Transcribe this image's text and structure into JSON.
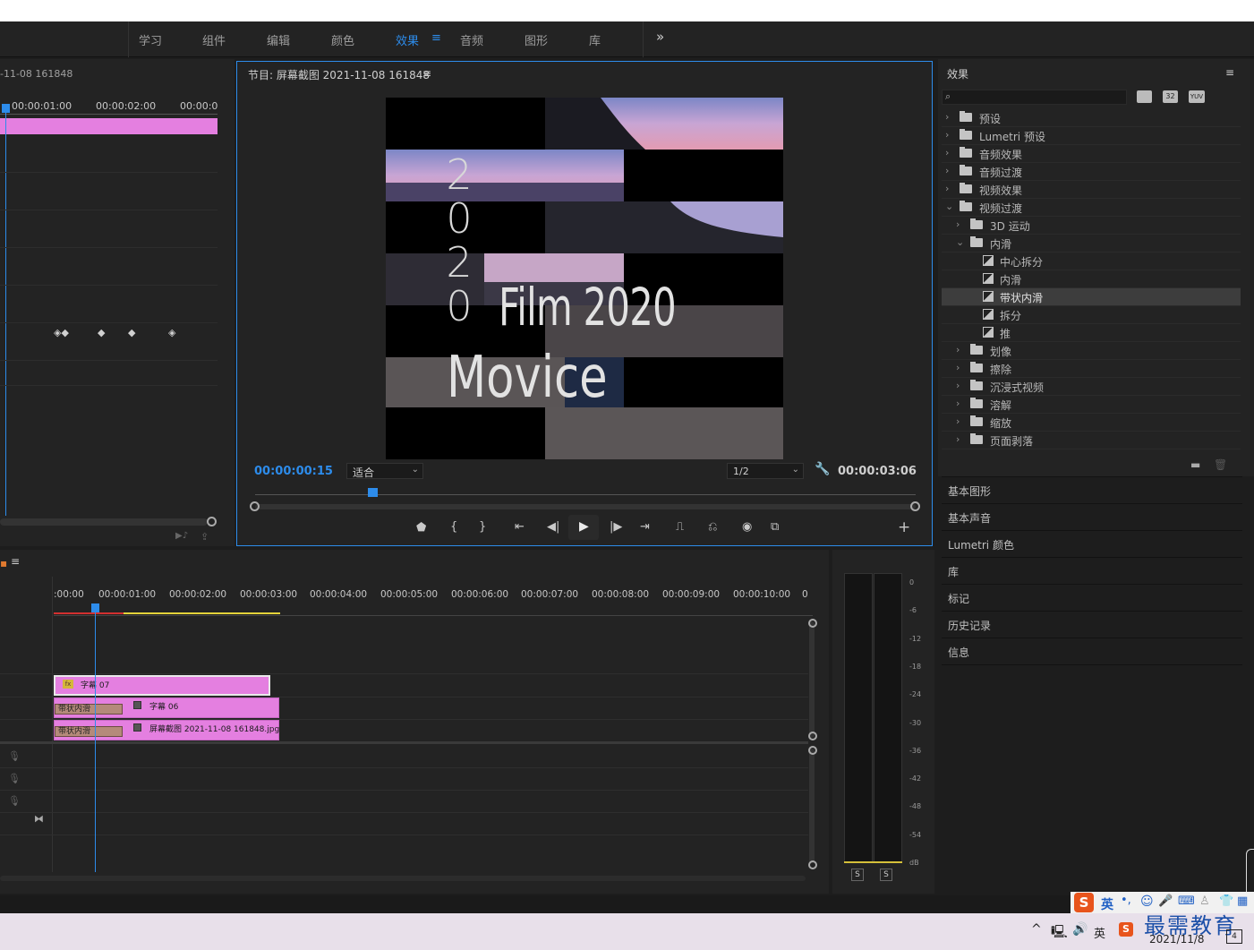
{
  "workspace_tabs": [
    {
      "label": "学习"
    },
    {
      "label": "组件"
    },
    {
      "label": "编辑"
    },
    {
      "label": "颜色"
    },
    {
      "label": "效果"
    },
    {
      "label": "音频"
    },
    {
      "label": "图形"
    },
    {
      "label": "库"
    }
  ],
  "workspace_more": "»",
  "source_panel": {
    "title": "-11-08 161848",
    "ruler": [
      "00:00:01:00",
      "00:00:02:00",
      "00:00:0"
    ]
  },
  "program_monitor": {
    "title": "节目: 屏幕截图 2021-11-08 161848",
    "menu_icon": "≡",
    "timecode": "00:00:00:15",
    "fit_select": "适合",
    "resolution_select": "1/2",
    "duration": "00:00:03:06",
    "video_text": {
      "vertical": [
        "2",
        "0",
        "2",
        "0"
      ],
      "line1": "Film 2020",
      "line2": "Movice"
    }
  },
  "effects_panel": {
    "title": "效果",
    "menu_icon": "≡",
    "search_placeholder": "",
    "filter_badges": [
      "32",
      "YUV"
    ],
    "tree": [
      {
        "label": "预设",
        "icon": "preset-folder-icon",
        "level": 0,
        "expanded": false
      },
      {
        "label": "Lumetri 预设",
        "icon": "preset-folder-icon",
        "level": 0,
        "expanded": false
      },
      {
        "label": "音频效果",
        "icon": "folder-icon",
        "level": 0,
        "expanded": false
      },
      {
        "label": "音频过渡",
        "icon": "folder-icon",
        "level": 0,
        "expanded": false
      },
      {
        "label": "视频效果",
        "icon": "folder-icon",
        "level": 0,
        "expanded": false
      },
      {
        "label": "视频过渡",
        "icon": "folder-icon",
        "level": 0,
        "expanded": true
      },
      {
        "label": "3D 运动",
        "icon": "folder-icon",
        "level": 1,
        "expanded": false
      },
      {
        "label": "内滑",
        "icon": "folder-icon",
        "level": 1,
        "expanded": true
      },
      {
        "label": "中心拆分",
        "icon": "transition-icon",
        "level": 2
      },
      {
        "label": "内滑",
        "icon": "transition-icon",
        "level": 2
      },
      {
        "label": "带状内滑",
        "icon": "transition-icon",
        "level": 2,
        "selected": true
      },
      {
        "label": "拆分",
        "icon": "transition-icon",
        "level": 2
      },
      {
        "label": "推",
        "icon": "transition-icon",
        "level": 2
      },
      {
        "label": "划像",
        "icon": "folder-icon",
        "level": 1,
        "expanded": false
      },
      {
        "label": "擦除",
        "icon": "folder-icon",
        "level": 1,
        "expanded": false
      },
      {
        "label": "沉浸式视频",
        "icon": "folder-icon",
        "level": 1,
        "expanded": false
      },
      {
        "label": "溶解",
        "icon": "folder-icon",
        "level": 1,
        "expanded": false
      },
      {
        "label": "缩放",
        "icon": "folder-icon",
        "level": 1,
        "expanded": false
      },
      {
        "label": "页面剥落",
        "icon": "folder-icon",
        "level": 1,
        "expanded": false
      }
    ]
  },
  "side_panels": [
    {
      "label": "基本图形"
    },
    {
      "label": "基本声音"
    },
    {
      "label": "Lumetri 颜色"
    },
    {
      "label": "库"
    },
    {
      "label": "标记"
    },
    {
      "label": "历史记录"
    },
    {
      "label": "信息"
    }
  ],
  "timeline": {
    "menu_icon": "≡",
    "ruler": [
      ":00:00",
      "00:00:01:00",
      "00:00:02:00",
      "00:00:03:00",
      "00:00:04:00",
      "00:00:05:00",
      "00:00:06:00",
      "00:00:07:00",
      "00:00:08:00",
      "00:00:09:00",
      "00:00:10:00",
      "0"
    ],
    "clips": [
      {
        "label": "字幕 07",
        "badge": "fx"
      },
      {
        "label": "字幕 06",
        "transition": "带状内滑"
      },
      {
        "label": "屏幕截图 2021-11-08 161848.jpg",
        "transition": "带状内滑"
      }
    ]
  },
  "audio_meter": {
    "scale": [
      "0",
      "-6",
      "-12",
      "-18",
      "-24",
      "-30",
      "-36",
      "-42",
      "-48",
      "-54",
      "dB"
    ],
    "solo_buttons": [
      "S",
      "S"
    ]
  },
  "taskbar": {
    "ime_label": "英",
    "watermark": "最需教育",
    "date": "2021/11/8",
    "lang": "英",
    "notif_count": "4"
  },
  "colors": {
    "accent": "#2d8ceb",
    "clip_pink": "#e47fe0",
    "panel_bg": "#232323",
    "transition": "#b48a7a"
  }
}
